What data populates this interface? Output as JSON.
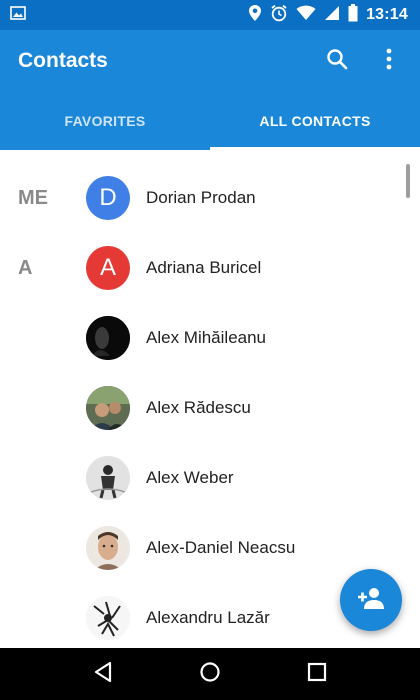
{
  "status_bar": {
    "time": "13:14",
    "icons": [
      "gallery-icon",
      "location-icon",
      "alarm-icon",
      "wifi-icon",
      "signal-icon",
      "battery-icon"
    ]
  },
  "app_bar": {
    "title": "Contacts",
    "actions": [
      "search-icon",
      "more-vert-icon"
    ]
  },
  "tabs": [
    {
      "label": "FAVORITES",
      "active": false
    },
    {
      "label": "ALL CONTACTS",
      "active": true
    }
  ],
  "contacts": [
    {
      "section": "ME",
      "name": "Dorian Prodan",
      "avatar_letter": "D",
      "avatar_color": "#3f7fe6"
    },
    {
      "section": "A",
      "name": "Adriana Buricel",
      "avatar_letter": "A",
      "avatar_color": "#e53935"
    },
    {
      "section": "",
      "name": "Alex Mihăileanu",
      "avatar_letter": "",
      "avatar_color": "#111111"
    },
    {
      "section": "",
      "name": "Alex Rădescu",
      "avatar_letter": "",
      "avatar_color": "#4e5b4a"
    },
    {
      "section": "",
      "name": "Alex Weber",
      "avatar_letter": "",
      "avatar_color": "#dcdcdc"
    },
    {
      "section": "",
      "name": "Alex-Daniel Neacsu",
      "avatar_letter": "",
      "avatar_color": "#c9a58a"
    },
    {
      "section": "",
      "name": "Alexandru Lazăr",
      "avatar_letter": "",
      "avatar_color": "#f2f2f2"
    }
  ],
  "fab": {
    "icon": "add-person-icon"
  },
  "nav_bar": {
    "buttons": [
      "back-icon",
      "home-icon",
      "recents-icon"
    ]
  },
  "colors": {
    "primary": "#1a87d9",
    "primary_dark": "#0b6fc4",
    "accent": "#1a87d9"
  }
}
